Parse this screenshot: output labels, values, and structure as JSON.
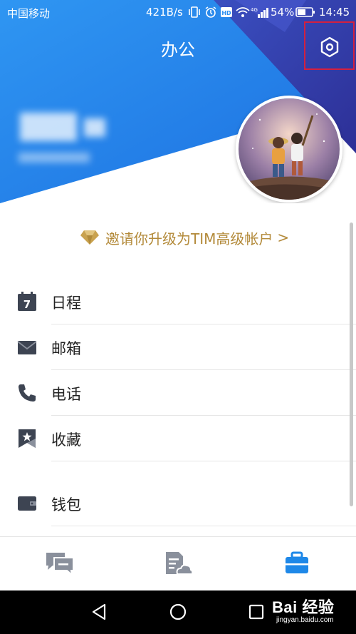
{
  "status_bar": {
    "carrier": "中国移动",
    "network_speed": "421B/s",
    "battery_percent": "54%",
    "time": "14:45",
    "icons": [
      "vibrate-icon",
      "alarm-icon",
      "hd-icon",
      "wifi-icon",
      "signal-4g-icon",
      "battery-icon"
    ]
  },
  "header": {
    "title": "办公",
    "settings_icon": "gear-hexagon-icon",
    "colors": {
      "primary_blue": "#2a8ef0",
      "dark_indigo": "#3b3ea8"
    }
  },
  "profile": {
    "name_blurred": true,
    "avatar": "avatar-photo"
  },
  "upgrade": {
    "text": "邀请你升级为TIM高级帐户",
    "chevron": ">",
    "icon": "diamond-icon",
    "color": "#b38a3a"
  },
  "menu": {
    "items": [
      {
        "label": "日程",
        "icon": "calendar-icon",
        "badge_number": "7"
      },
      {
        "label": "邮箱",
        "icon": "mail-icon"
      },
      {
        "label": "电话",
        "icon": "phone-icon"
      },
      {
        "label": "收藏",
        "icon": "bookmark-star-icon"
      },
      {
        "label": "钱包",
        "icon": "wallet-icon"
      }
    ]
  },
  "tabs": [
    {
      "name": "messages",
      "icon": "chat-bubbles-icon",
      "active": false
    },
    {
      "name": "documents",
      "icon": "doc-cloud-icon",
      "active": false
    },
    {
      "name": "office",
      "icon": "briefcase-icon",
      "active": true
    }
  ],
  "system_nav": {
    "buttons": [
      "back-icon",
      "home-icon",
      "recents-icon"
    ]
  },
  "watermark": {
    "main": "Bai 经验",
    "sub": "jingyan.baidu.com"
  }
}
